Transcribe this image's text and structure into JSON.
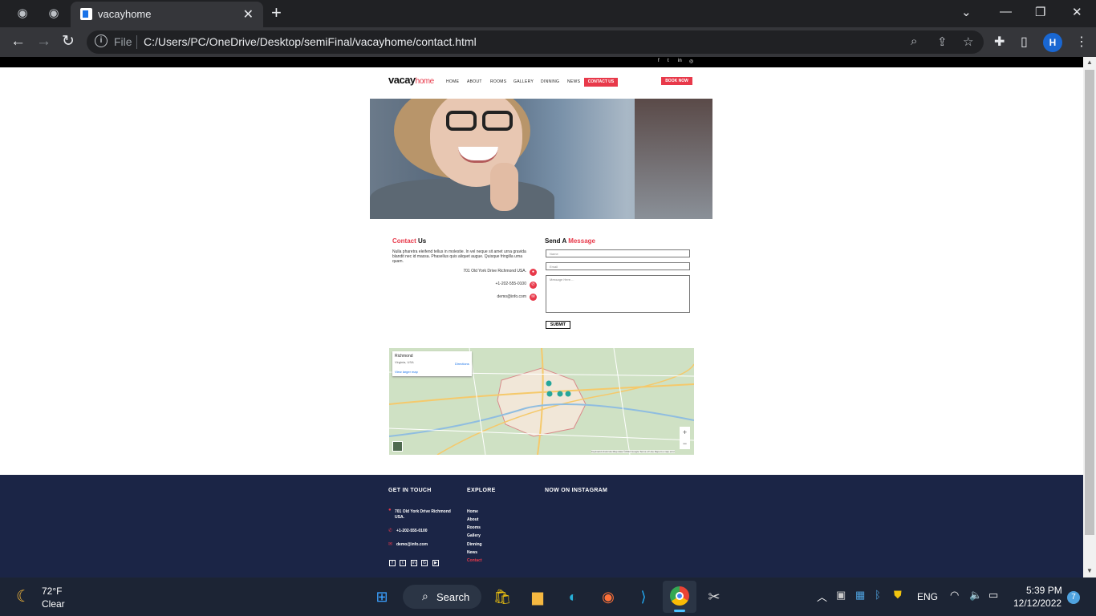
{
  "browser": {
    "tab_title": "vacayhome",
    "scheme": "File",
    "url": "C:/Users/PC/OneDrive/Desktop/semiFinal/vacayhome/contact.html",
    "profile_initial": "H"
  },
  "site": {
    "logo_main": "vacay",
    "logo_accent": "home",
    "nav": [
      "HOME",
      "ABOUT",
      "ROOMS",
      "GALLERY",
      "DINNING",
      "NEWS"
    ],
    "nav_active": "CONTACT US",
    "book_now": "BOOK NOW",
    "social": [
      "f",
      "t",
      "in",
      "◎"
    ]
  },
  "contact": {
    "heading_accent": "Contact",
    "heading_rest": " Us",
    "description": "Nulla pharetra eleifend tellus in molestie. In vel neque sit amet urna gravida blandit nec id massa. Phasellus quis aliquet augue. Quisque fringilla urna quam.",
    "address": "701 Old York Drive Richmond USA.",
    "phone": "+1-202-555-0100",
    "email": "demo@info.com"
  },
  "form": {
    "heading_rest": "Send A ",
    "heading_accent": "Message",
    "name_placeholder": "Name",
    "email_placeholder": "Email",
    "message_placeholder": "Message Here....",
    "submit": "SUBMIT"
  },
  "map": {
    "place": "Richmond",
    "region": "Virginia, USA",
    "directions": "Directions",
    "larger_map": "View larger map",
    "attribution": "Keyboard shortcuts   Map data ©2022 Google   Terms of Use   Report a map error"
  },
  "footer": {
    "col1_heading": "GET IN TOUCH",
    "col1_address": "701 Old York Drive Richmond USA.",
    "col1_phone": "+1-202-555-0100",
    "col1_email": "demo@info.com",
    "col2_heading": "EXPLORE",
    "links": [
      "Home",
      "About",
      "Rooms",
      "Gallery",
      "Dinning",
      "News"
    ],
    "active_link": "Contact",
    "col3_heading": "NOW ON INSTAGRAM"
  },
  "taskbar": {
    "temperature": "72°F",
    "weather": "Clear",
    "search": "Search",
    "language": "ENG",
    "time": "5:39 PM",
    "date": "12/12/2022",
    "notifications": "7"
  }
}
